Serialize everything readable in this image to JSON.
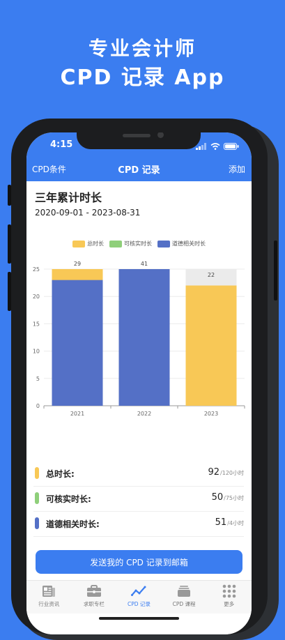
{
  "promo": {
    "line1": "专业会计师",
    "line2": "CPD 记录 App"
  },
  "status_bar": {
    "time": "4:15"
  },
  "nav": {
    "left": "CPD条件",
    "title": "CPD 记录",
    "right": "添加"
  },
  "section": {
    "title": "三年累计时长",
    "date_range": "2020-09-01 - 2023-08-31"
  },
  "chart_data": {
    "type": "bar",
    "stacked": true,
    "categories": [
      "2021",
      "2022",
      "2023"
    ],
    "series": [
      {
        "name": "总时长",
        "color": "#f8c856",
        "values": [
          29,
          41,
          22
        ]
      },
      {
        "name": "可核实时长",
        "color": "#8fcf7a",
        "values": [
          23,
          25,
          0
        ]
      },
      {
        "name": "道德相关时长",
        "color": "#5470c6",
        "values": [
          23,
          25,
          0
        ]
      }
    ],
    "totals_labels": [
      "29",
      "41",
      "22"
    ],
    "y_ticks": [
      "0",
      "5",
      "10",
      "15",
      "20",
      "25"
    ],
    "ylim": [
      0,
      25
    ],
    "legend_position": "top-center",
    "grid": true
  },
  "summary": [
    {
      "label": "总时长:",
      "value": "92",
      "unit": "/120小时",
      "color": "#f8c856"
    },
    {
      "label": "可核实时长:",
      "value": "50",
      "unit": "/75小时",
      "color": "#8fcf7a"
    },
    {
      "label": "道德相关时长:",
      "value": "51",
      "unit": "/4小时",
      "color": "#5470c6"
    }
  ],
  "send_button": "发送我的 CPD 记录到邮箱",
  "tabs": [
    {
      "label": "行业资讯",
      "icon": "newspaper-icon"
    },
    {
      "label": "求职专栏",
      "icon": "briefcase-icon"
    },
    {
      "label": "CPD 记录",
      "icon": "trend-line-icon",
      "active": true
    },
    {
      "label": "CPD 课程",
      "icon": "stack-icon"
    },
    {
      "label": "更多",
      "icon": "grid-dots-icon"
    }
  ]
}
